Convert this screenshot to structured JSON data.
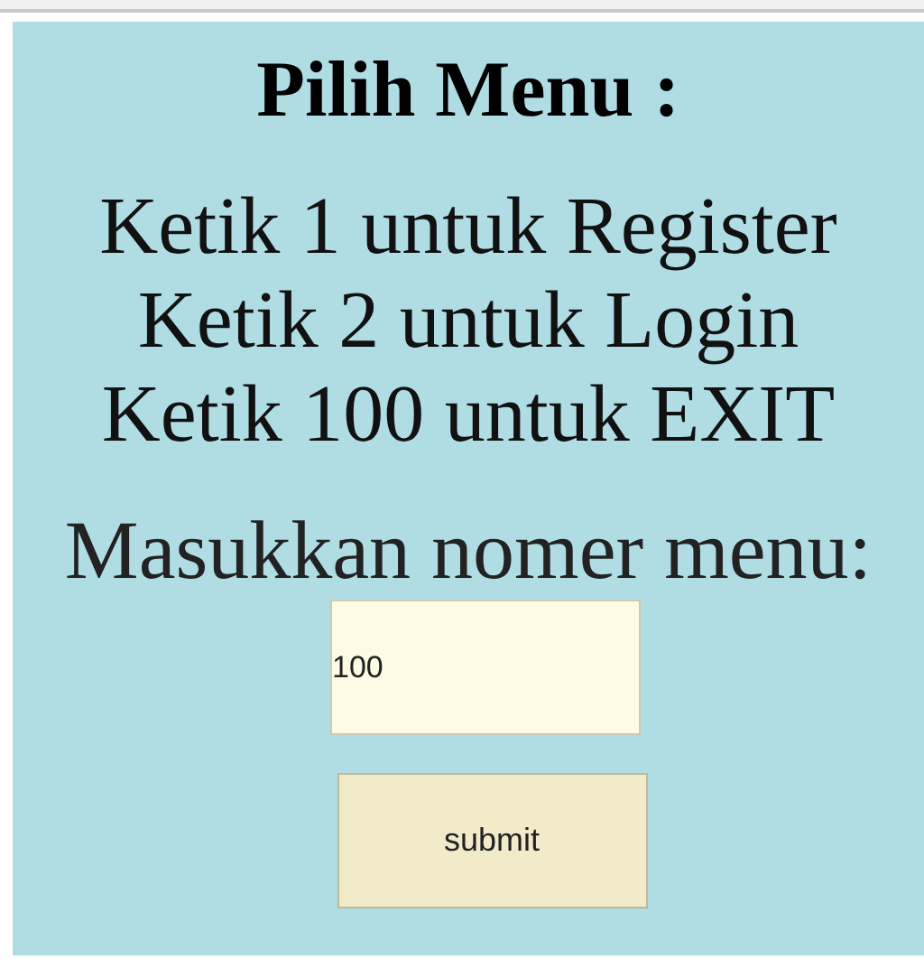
{
  "title": "Pilih Menu :",
  "options": [
    "Ketik 1 untuk Register",
    "Ketik 2 untuk Login",
    "Ketik 100 untuk EXIT"
  ],
  "prompt": "Masukkan nomer menu:",
  "field": {
    "value": "100"
  },
  "button": "submit"
}
